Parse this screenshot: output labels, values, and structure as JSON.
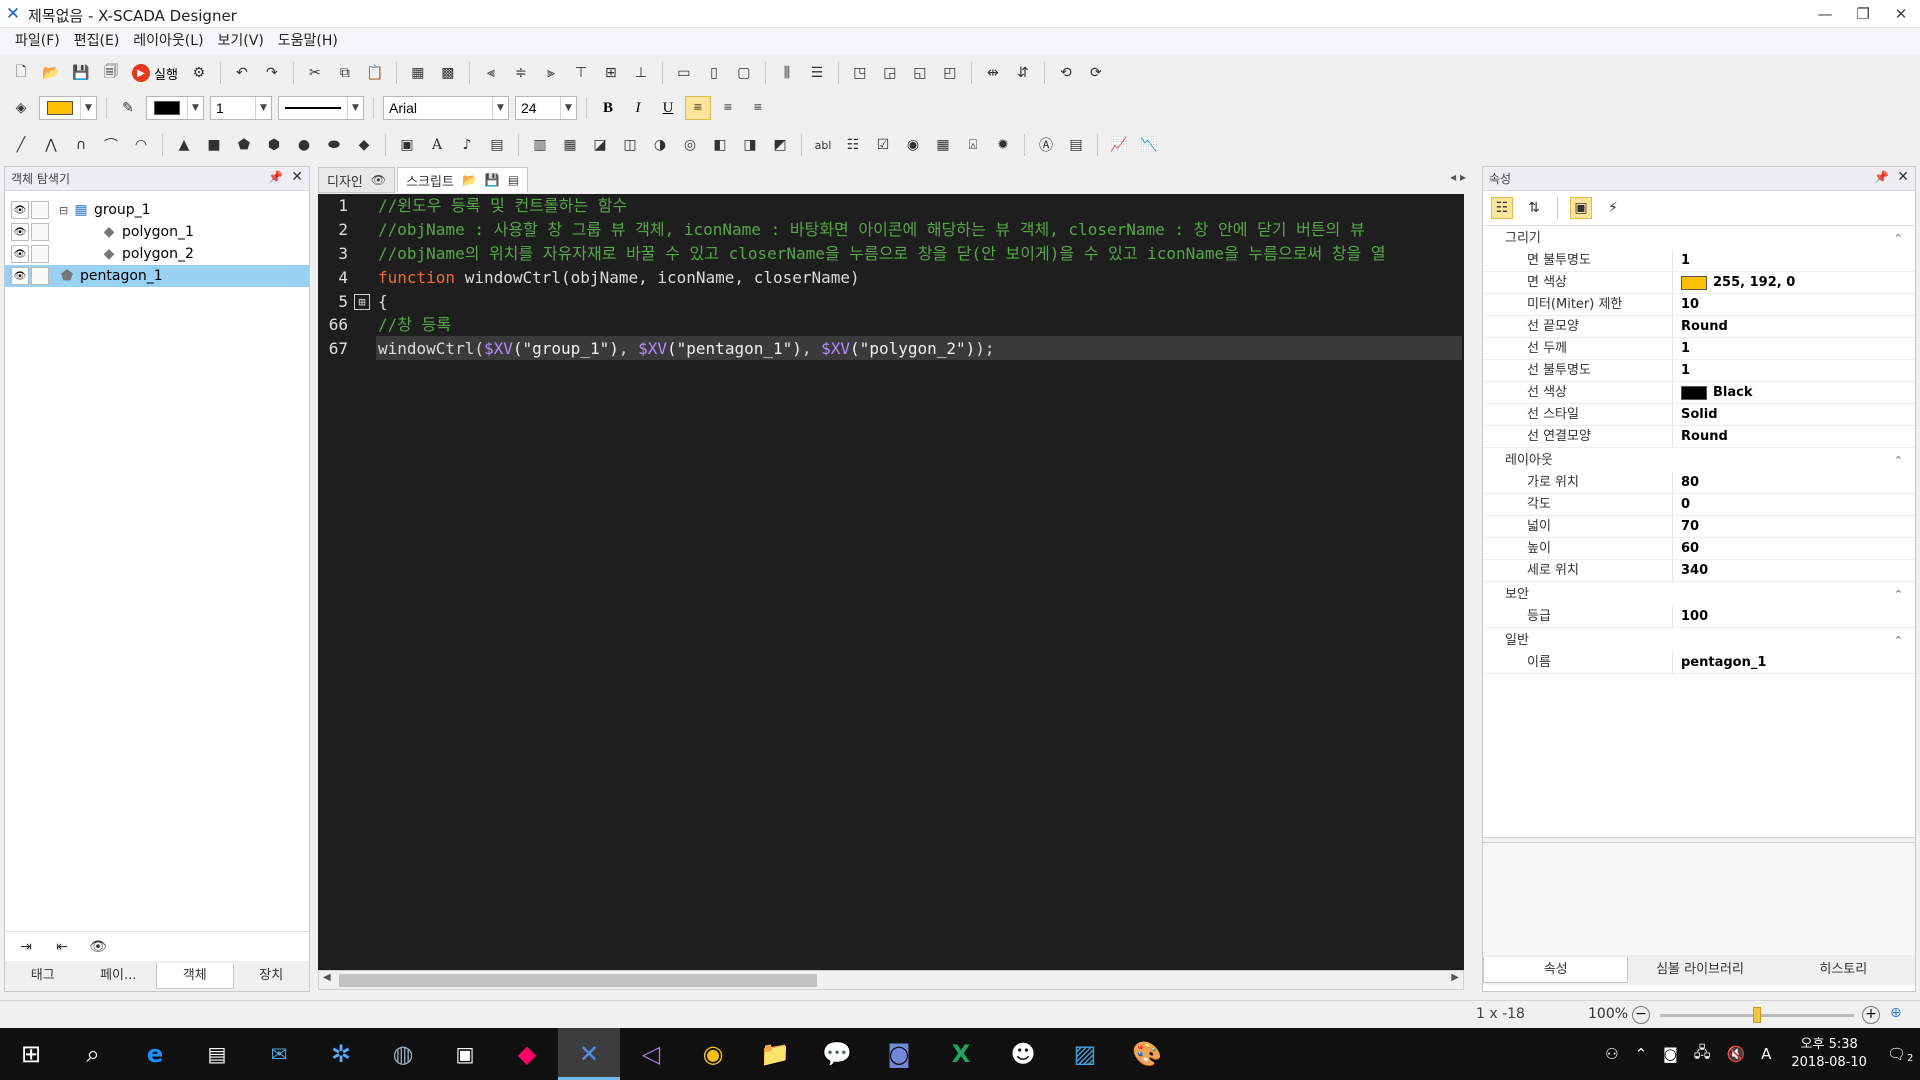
{
  "window": {
    "title": "제목없음 - X-SCADA Designer",
    "controls": [
      "—",
      "❐",
      "✕"
    ]
  },
  "menu": [
    "파일(F)",
    "편집(E)",
    "레이아웃(L)",
    "보기(V)",
    "도움말(H)"
  ],
  "toolbar": {
    "run_label": "실행",
    "fill_color": "#ffc000",
    "line_color": "#000000",
    "line_width": "1",
    "font_family": "Arial",
    "font_size": "24",
    "bold": "B",
    "italic": "I",
    "underline": "U"
  },
  "explorer": {
    "title": "객체 탐색기",
    "items": [
      {
        "label": "group_1",
        "level": 0
      },
      {
        "label": "polygon_1",
        "level": 2
      },
      {
        "label": "polygon_2",
        "level": 2
      },
      {
        "label": "pentagon_1",
        "level": 0
      }
    ],
    "tabs": [
      "태그",
      "페이...",
      "객체",
      "장치"
    ]
  },
  "editor": {
    "tabs": [
      "디자인",
      "스크립트"
    ],
    "line_numbers": [
      "1",
      "2",
      "3",
      "4",
      "5",
      "66",
      "67"
    ],
    "lines": [
      "//윈도우 등록 및 컨트롤하는 함수",
      "//objName : 사용할 창 그룹 뷰 객체, iconName : 바탕화면 아이콘에 해당하는 뷰 객체, closerName : 창 안에 닫기 버튼의 뷰",
      "//objName의 위치를 자유자재로 바꿀 수 있고 closerName을 누름으로 창을 닫(안 보이게)을 수 있고 iconName을 누름으로써 창을 열",
      "windowCtrl(objName, iconName, closerName)",
      "{",
      "//창 등록",
      "windowCtrl($XV(\"group_1\"), $XV(\"pentagon_1\"), $XV(\"polygon_2\"));"
    ],
    "keyword": "function",
    "fold_symbol": "⊞"
  },
  "properties": {
    "title": "속성",
    "categories": [
      {
        "name": "그리기",
        "rows": [
          {
            "name": "면 불투명도",
            "value": "1"
          },
          {
            "name": "면 색상",
            "value": "255, 192, 0",
            "swatch": "#ffc000"
          },
          {
            "name": "미터(Miter) 제한",
            "value": "10"
          },
          {
            "name": "선 끝모양",
            "value": "Round"
          },
          {
            "name": "선 두께",
            "value": "1"
          },
          {
            "name": "선 불투명도",
            "value": "1"
          },
          {
            "name": "선 색상",
            "value": "Black",
            "swatch": "#000000"
          },
          {
            "name": "선 스타일",
            "value": "Solid"
          },
          {
            "name": "선 연결모양",
            "value": "Round"
          }
        ]
      },
      {
        "name": "레이아웃",
        "rows": [
          {
            "name": "가로 위치",
            "value": "80"
          },
          {
            "name": "각도",
            "value": "0"
          },
          {
            "name": "넓이",
            "value": "70"
          },
          {
            "name": "높이",
            "value": "60"
          },
          {
            "name": "세로 위치",
            "value": "340"
          }
        ]
      },
      {
        "name": "보안",
        "rows": [
          {
            "name": "등급",
            "value": "100"
          }
        ]
      },
      {
        "name": "일반",
        "rows": [
          {
            "name": "이름",
            "value": "pentagon_1"
          }
        ]
      }
    ],
    "tabs": [
      "속성",
      "심볼 라이브러리",
      "히스토리"
    ]
  },
  "status": {
    "position": "1 x -18",
    "zoom": "100%",
    "zoom_fraction": 0.5
  },
  "taskbar": {
    "time": "오후 5:38",
    "date": "2018-08-10",
    "ime": "A",
    "notifications": "2"
  }
}
